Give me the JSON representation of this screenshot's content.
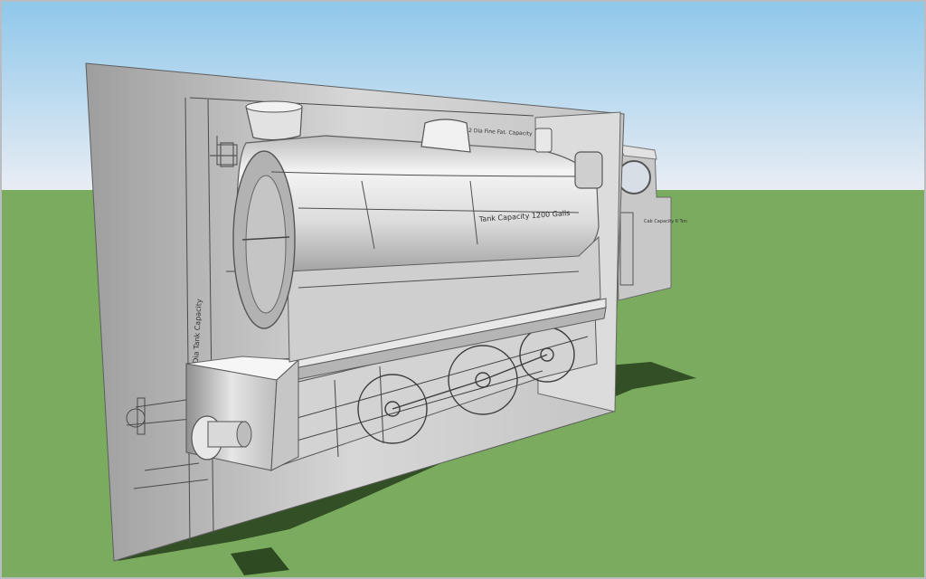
{
  "scene": {
    "sky_top": "#8ec7ea",
    "sky_bottom": "#e8ecf3",
    "ground": "#7aab5f",
    "ground_far": "#6e9e55",
    "shadow": "#2e4a22",
    "model_light": "#f2f2f2",
    "model_mid": "#c9c9c9",
    "model_dark": "#8a8a8a",
    "line_color": "#4a4a4a",
    "status_text": ""
  },
  "drawing_annotations": {
    "tank_label": "Tank Capacity 1200 Galls",
    "dim_left": "Car. Dia Tank Capacity",
    "dim_top": "2 Dia Fine Fat. Capacity",
    "cab_label": "Cab Capacity 6 Ton"
  }
}
